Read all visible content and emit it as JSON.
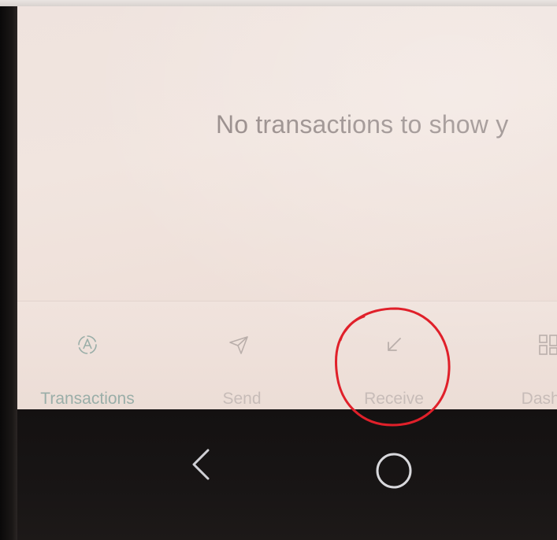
{
  "main": {
    "empty_message": "No transactions to show y"
  },
  "bottom_nav": {
    "items": [
      {
        "label": "Transactions",
        "icon": "transactions-icon",
        "active": true
      },
      {
        "label": "Send",
        "icon": "send-icon",
        "active": false
      },
      {
        "label": "Receive",
        "icon": "receive-icon",
        "active": false
      },
      {
        "label": "Dashb",
        "icon": "dashboard-icon",
        "active": false
      }
    ]
  },
  "system_nav": {
    "back": "back-icon",
    "home": "home-icon"
  },
  "colors": {
    "screen_background": "#efe3de",
    "active_accent": "#9aaea8",
    "inactive_label": "#c7bcb8",
    "empty_text": "#928684",
    "annotation_circle": "#e0202a",
    "phone_bar": "#151212"
  }
}
